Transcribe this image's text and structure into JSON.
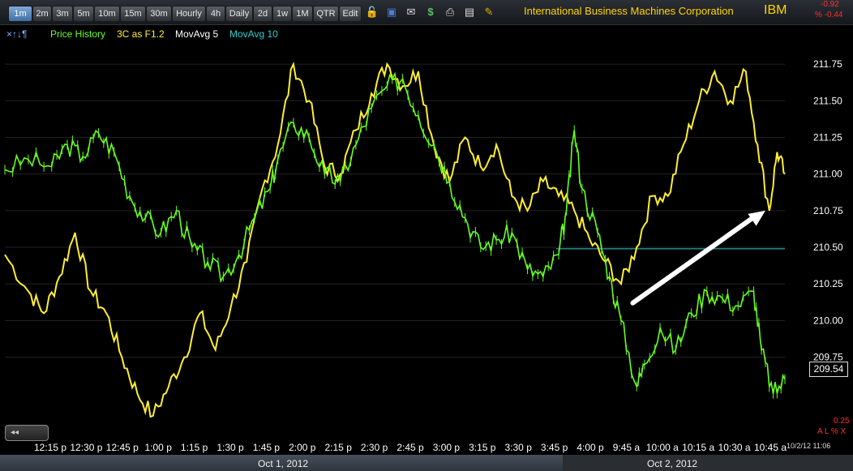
{
  "toolbar": {
    "intervals": [
      "1m",
      "2m",
      "3m",
      "5m",
      "10m",
      "15m",
      "30m",
      "Hourly",
      "4h",
      "Daily",
      "2d",
      "1w",
      "1M",
      "QTR",
      "Edit"
    ],
    "active_interval": "1m",
    "icons": [
      "lock-icon",
      "save-icon",
      "mail-icon",
      "dollar-icon",
      "print-icon",
      "card-icon",
      "pencil-icon"
    ]
  },
  "header": {
    "company": "International Business Machines Corporation",
    "symbol": "IBM",
    "change": "-0.92",
    "change_pct": "% -0.44"
  },
  "legend": {
    "arrows": "×↑↓¶",
    "price_history": "Price History",
    "threec": "3C as F1.2",
    "ma5": "MovAvg 5",
    "ma10": "MovAvg 10"
  },
  "colors": {
    "price": "#66ff22",
    "threec": "#ffee33",
    "ma_line": "#33cccc",
    "arrow": "#ffffff",
    "axis_text": "#ffffff"
  },
  "price_box": "209.54",
  "scale_min": "0.25",
  "scale_ctrl": "A L % X",
  "timestamp": "10/2/12 11:06",
  "dates": [
    "Oct 1, 2012",
    "Oct 2, 2012"
  ],
  "scroll_label": "◂◂",
  "chart_data": {
    "type": "line",
    "x_ticks": [
      "12:15 p",
      "12:30 p",
      "12:45 p",
      "1:00 p",
      "1:15 p",
      "1:30 p",
      "1:45 p",
      "2:00 p",
      "2:15 p",
      "2:30 p",
      "2:45 p",
      "3:00 p",
      "3:15 p",
      "3:30 p",
      "3:45 p",
      "4:00 p",
      "9:45 a",
      "10:00 a",
      "10:15 a",
      "10:30 a",
      "10:45 a"
    ],
    "y_ticks": [
      "211.75",
      "211.50",
      "211.25",
      "211.00",
      "210.75",
      "210.50",
      "210.25",
      "210.00",
      "209.75"
    ],
    "ylim": [
      209.2,
      211.9
    ],
    "horizontal_line": 210.49,
    "price_series": {
      "name": "Price History",
      "points": [
        [
          0.0,
          211.03
        ],
        [
          0.03,
          211.1
        ],
        [
          0.06,
          211.05
        ],
        [
          0.08,
          211.2
        ],
        [
          0.1,
          211.12
        ],
        [
          0.12,
          211.28
        ],
        [
          0.14,
          211.15
        ],
        [
          0.16,
          210.85
        ],
        [
          0.18,
          210.7
        ],
        [
          0.2,
          210.6
        ],
        [
          0.22,
          210.75
        ],
        [
          0.24,
          210.5
        ],
        [
          0.26,
          210.4
        ],
        [
          0.28,
          210.3
        ],
        [
          0.3,
          210.45
        ],
        [
          0.32,
          210.7
        ],
        [
          0.34,
          210.9
        ],
        [
          0.35,
          211.1
        ],
        [
          0.37,
          211.35
        ],
        [
          0.39,
          211.25
        ],
        [
          0.41,
          211.0
        ],
        [
          0.43,
          210.95
        ],
        [
          0.45,
          211.2
        ],
        [
          0.47,
          211.45
        ],
        [
          0.49,
          211.6
        ],
        [
          0.51,
          211.65
        ],
        [
          0.53,
          211.4
        ],
        [
          0.55,
          211.2
        ],
        [
          0.57,
          210.95
        ],
        [
          0.59,
          210.7
        ],
        [
          0.61,
          210.5
        ],
        [
          0.63,
          210.55
        ],
        [
          0.65,
          210.6
        ],
        [
          0.67,
          210.35
        ],
        [
          0.69,
          210.3
        ],
        [
          0.71,
          210.45
        ],
        [
          0.72,
          210.75
        ],
        [
          0.73,
          211.3
        ],
        [
          0.74,
          210.9
        ],
        [
          0.76,
          210.6
        ],
        [
          0.775,
          210.3
        ],
        [
          0.79,
          210.0
        ],
        [
          0.81,
          209.55
        ],
        [
          0.82,
          209.7
        ],
        [
          0.84,
          209.95
        ],
        [
          0.86,
          209.8
        ],
        [
          0.88,
          210.05
        ],
        [
          0.9,
          210.2
        ],
        [
          0.92,
          210.15
        ],
        [
          0.94,
          210.1
        ],
        [
          0.96,
          210.2
        ],
        [
          0.97,
          209.8
        ],
        [
          0.985,
          209.5
        ],
        [
          1.0,
          209.6
        ]
      ]
    },
    "threec_series": {
      "name": "3C as F1.2",
      "points": [
        [
          0.0,
          210.45
        ],
        [
          0.03,
          210.2
        ],
        [
          0.05,
          210.05
        ],
        [
          0.07,
          210.3
        ],
        [
          0.09,
          210.6
        ],
        [
          0.11,
          210.2
        ],
        [
          0.13,
          210.05
        ],
        [
          0.15,
          209.75
        ],
        [
          0.17,
          209.5
        ],
        [
          0.19,
          209.35
        ],
        [
          0.21,
          209.55
        ],
        [
          0.23,
          209.75
        ],
        [
          0.25,
          210.05
        ],
        [
          0.27,
          209.8
        ],
        [
          0.29,
          210.1
        ],
        [
          0.31,
          210.4
        ],
        [
          0.33,
          210.9
        ],
        [
          0.35,
          211.2
        ],
        [
          0.37,
          211.75
        ],
        [
          0.39,
          211.5
        ],
        [
          0.41,
          211.05
        ],
        [
          0.43,
          211.0
        ],
        [
          0.45,
          211.3
        ],
        [
          0.47,
          211.55
        ],
        [
          0.49,
          211.75
        ],
        [
          0.51,
          211.6
        ],
        [
          0.53,
          211.7
        ],
        [
          0.55,
          211.2
        ],
        [
          0.57,
          210.95
        ],
        [
          0.59,
          211.25
        ],
        [
          0.61,
          211.05
        ],
        [
          0.63,
          211.2
        ],
        [
          0.65,
          210.85
        ],
        [
          0.67,
          210.75
        ],
        [
          0.69,
          210.95
        ],
        [
          0.71,
          210.85
        ],
        [
          0.73,
          210.75
        ],
        [
          0.75,
          210.55
        ],
        [
          0.77,
          210.4
        ],
        [
          0.79,
          210.25
        ],
        [
          0.81,
          210.5
        ],
        [
          0.83,
          210.85
        ],
        [
          0.85,
          210.85
        ],
        [
          0.87,
          211.2
        ],
        [
          0.89,
          211.5
        ],
        [
          0.91,
          211.7
        ],
        [
          0.93,
          211.5
        ],
        [
          0.95,
          211.7
        ],
        [
          0.965,
          211.2
        ],
        [
          0.98,
          210.75
        ],
        [
          0.99,
          211.15
        ],
        [
          1.0,
          211.0
        ]
      ]
    },
    "annotation_arrow": {
      "from": [
        210.12
      ],
      "to": [
        210.75
      ]
    }
  }
}
